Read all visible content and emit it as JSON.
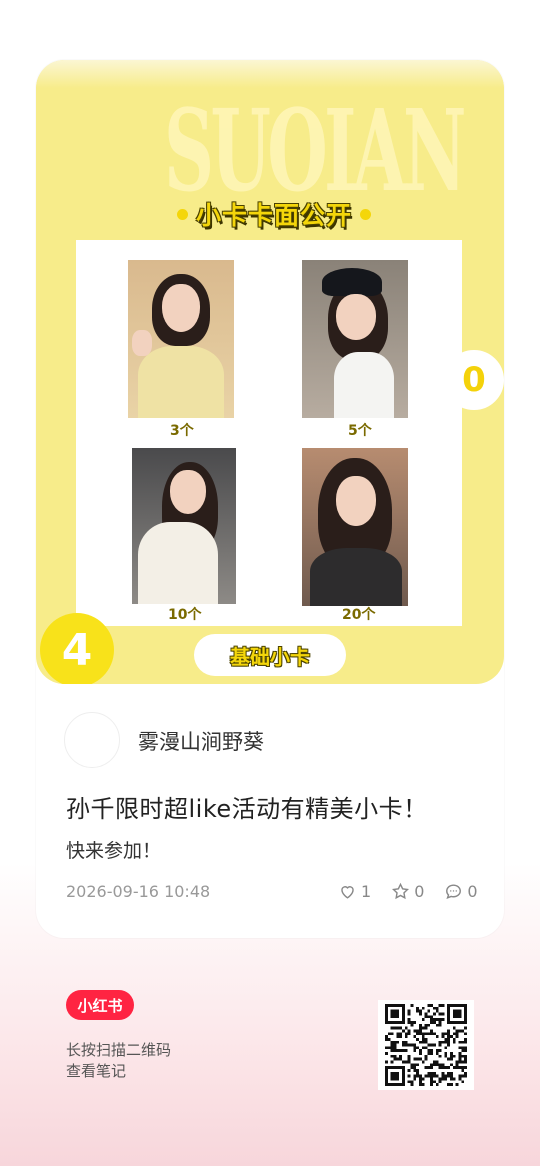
{
  "poster": {
    "bg_word": "SUOIAN",
    "headline": "小卡卡面公开",
    "cards": [
      {
        "count": "3个"
      },
      {
        "count": "5个"
      },
      {
        "count": "10个"
      },
      {
        "count": "20个"
      }
    ],
    "right_number": "0",
    "left_number": "4",
    "base_tag": "基础小卡"
  },
  "author": {
    "name": "雾漫山涧野葵"
  },
  "note": {
    "title": "孙千限时超like活动有精美小卡！",
    "desc": "快来参加！",
    "date": "2026-09-16 10:48"
  },
  "stats": {
    "likes": "1",
    "collects": "0",
    "comments": "0"
  },
  "footer": {
    "brand": "小红书",
    "hint_line1": "长按扫描二维码",
    "hint_line2": "查看笔记"
  },
  "colors": {
    "poster_bg": "#f7ec8a",
    "accent_yellow": "#f4d60a",
    "brand_red": "#ff2442"
  }
}
